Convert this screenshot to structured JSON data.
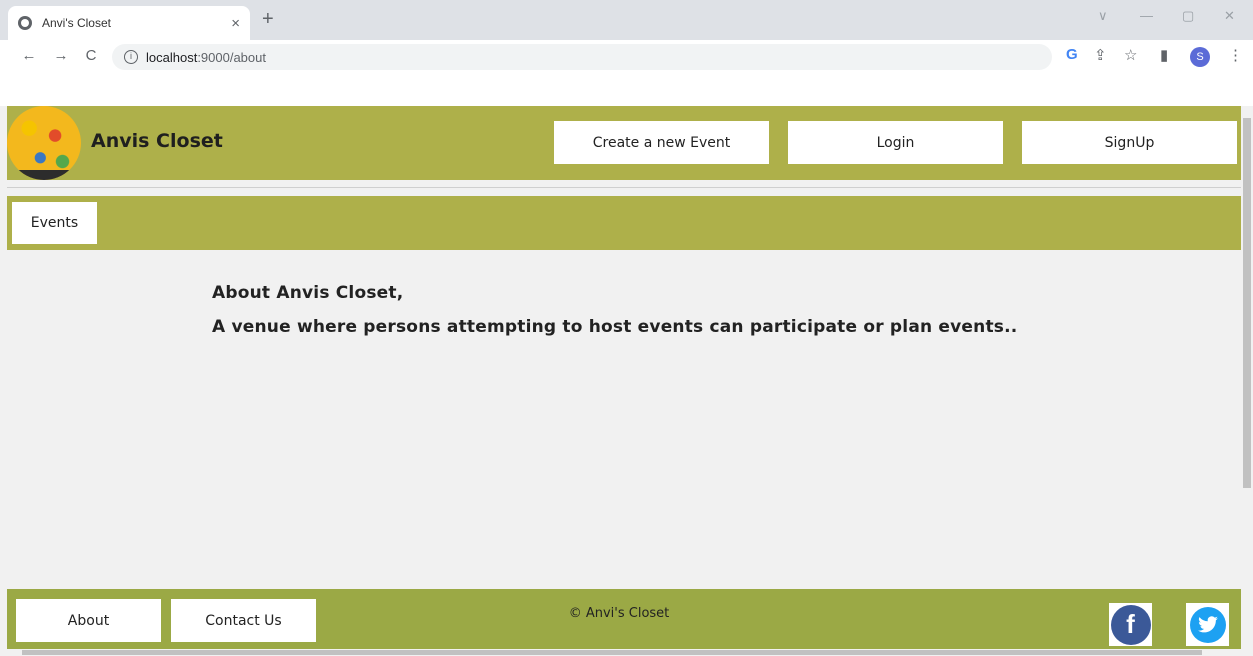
{
  "browser": {
    "tab_title": "Anvi's Closet",
    "tab_close": "×",
    "new_tab": "+",
    "url_host": "localhost",
    "url_rest": ":9000/about",
    "nav_back": "←",
    "nav_forward": "→",
    "nav_reload": "C",
    "info": "i",
    "g_letter": "G",
    "share": "⇪",
    "star": "☆",
    "panel": "▮",
    "profile_letter": "S",
    "menu": "⋮",
    "win_collapse": "∨",
    "win_minimize": "—",
    "win_restore": "▢",
    "win_close": "✕"
  },
  "header": {
    "brand": "Anvis Closet",
    "create_event": "Create a new Event",
    "login": "Login",
    "signup": "SignUp"
  },
  "subnav": {
    "events": "Events"
  },
  "content": {
    "line1": "About Anvis Closet,",
    "line2": "A venue where persons attempting to host events can participate or plan events.."
  },
  "footer": {
    "about": "About",
    "contact": "Contact Us",
    "copyright": "© Anvi's Closet",
    "facebook_letter": "f"
  },
  "colors": {
    "header_bg": "#aeb04a",
    "footer_bg": "#9ba945",
    "page_bg": "#f1f1f1"
  }
}
